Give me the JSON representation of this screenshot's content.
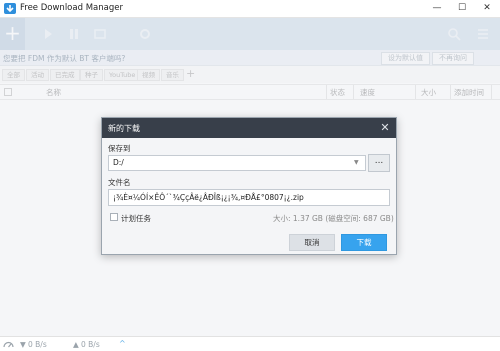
{
  "window": {
    "title": "Free Download Manager",
    "controls": {
      "minimize": "—",
      "maximize": "☐",
      "close": "✕"
    }
  },
  "toolbar": {
    "add_icon": "plus-icon",
    "icons": [
      "play-icon",
      "pause-icon",
      "stop-icon",
      "search-icon",
      "menu-icon"
    ]
  },
  "notice": {
    "text": "您要把 FDM 作为默认 BT 客户端吗?",
    "set_default": "设为默认值",
    "never_ask": "不再询问"
  },
  "filters": {
    "chips": [
      "全部",
      "活动",
      "已完成",
      "种子",
      "YouTube",
      "视频",
      "音乐"
    ],
    "add": "+"
  },
  "table": {
    "columns": {
      "name": "名称",
      "status": "状态",
      "speed": "速度",
      "size": "大小",
      "added": "添加时间"
    }
  },
  "dialog": {
    "title": "新的下载",
    "close": "✕",
    "save_to_label": "保存到",
    "save_to_value": "D:/",
    "browse": "...",
    "file_name_label": "文件名",
    "file_name_value": "¡¾È¤¼ÓÍ×ÊÔ´`¾ÇçÂë¿ÂÐÎß¡¿¡¾,¤ÐÅ£°0807¡¿.zip",
    "schedule_label": "计划任务",
    "size_text": "大小: 1.37 GB (磁盘空间: 687 GB)",
    "cancel": "取消",
    "download": "下载"
  },
  "statusbar": {
    "down_speed": "0 B/s",
    "up_speed": "0 B/s",
    "expand": "^"
  },
  "colors": {
    "toolbar": "#d8e3ee",
    "dialog_header": "#383f4a",
    "accent": "#37a3ee"
  }
}
